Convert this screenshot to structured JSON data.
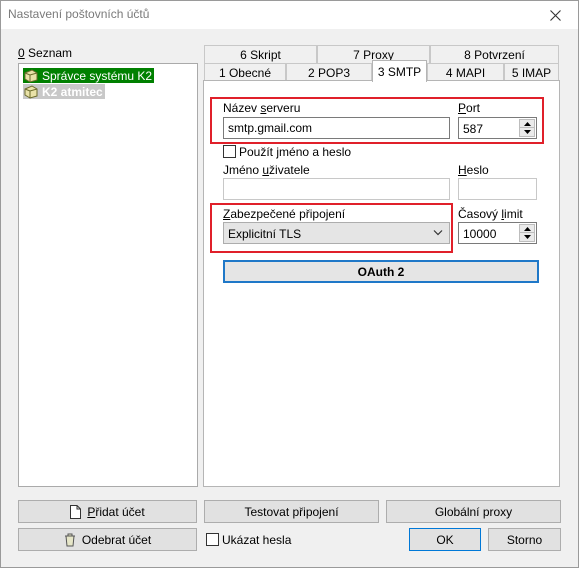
{
  "window": {
    "title": "Nastavení poštovních účtů"
  },
  "list": {
    "label_prefix": "0",
    "label_rest": " Seznam",
    "items": [
      {
        "label": "Správce systému K2",
        "icon": "account-icon"
      },
      {
        "label": "K2 atmitec",
        "icon": "account-icon"
      }
    ]
  },
  "tabs": {
    "top_row": [
      "6 Skript",
      "7 Proxy",
      "8 Potvrzení"
    ],
    "bottom_row": [
      "1 Obecné",
      "2 POP3",
      "3 SMTP",
      "4 MAPI",
      "5 IMAP"
    ],
    "active": "3 SMTP"
  },
  "smtp": {
    "server_label_a": "Název ",
    "server_label_u": "s",
    "server_label_b": "erveru",
    "server_value": "smtp.gmail.com",
    "port_label_u": "P",
    "port_label_b": "ort",
    "port_value": "587",
    "use_name_password_label": "Použít jméno a heslo",
    "username_label_a": "Jméno ",
    "username_label_u": "u",
    "username_label_b": "živatele",
    "username_value": "",
    "password_label_u": "H",
    "password_label_b": "eslo",
    "password_value": "",
    "secure_label_u": "Z",
    "secure_label_b": "abezpečené připojení",
    "secure_value": "Explicitní TLS",
    "timeout_label_a": "Časový ",
    "timeout_label_u": "l",
    "timeout_label_b": "imit",
    "timeout_value": "10000",
    "oauth_label": "OAuth 2"
  },
  "buttons": {
    "add_account_a": "P",
    "add_account_b": "řidat účet",
    "remove_account": "Odebrat účet",
    "test_connection": "Testovat připojení",
    "global_proxy": "Globální proxy",
    "show_passwords": "Ukázat hesla",
    "ok": "OK",
    "cancel": "Storno"
  },
  "colors": {
    "selected_item": "#008000",
    "highlight_box": "#e0202a",
    "oauth_border": "#1f78c8"
  }
}
